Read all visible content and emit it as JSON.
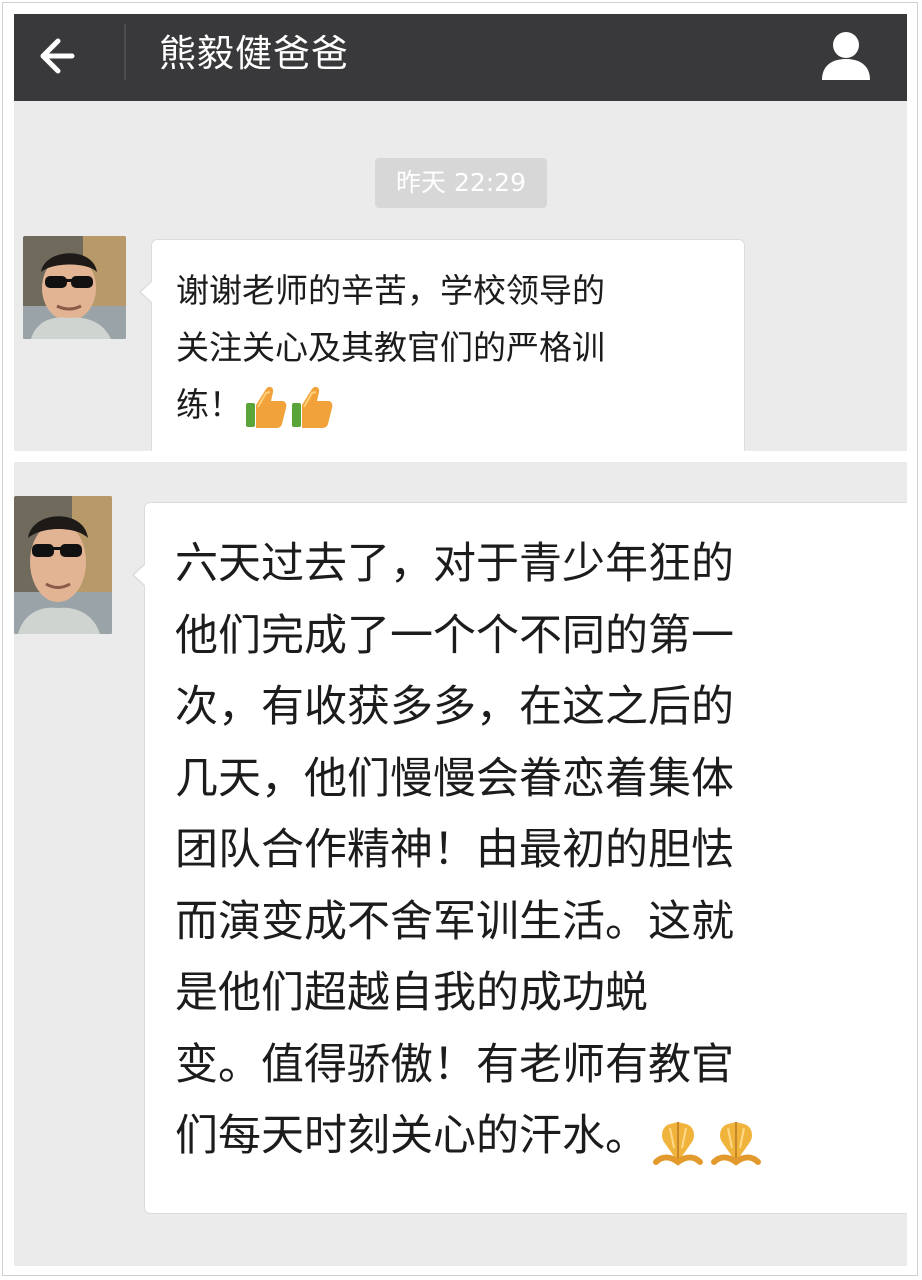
{
  "header": {
    "title": "熊毅健爸爸",
    "back_icon": "back-arrow-icon",
    "profile_icon": "person-icon"
  },
  "timestamp": "昨天 22:29",
  "messages": [
    {
      "avatar": "contact-avatar",
      "lines": [
        "谢谢老师的辛苦，学校领导的",
        "关注关心及其教官们的严格训",
        "练！"
      ],
      "emojis": [
        "thumbs-up-icon",
        "thumbs-up-icon"
      ]
    },
    {
      "avatar": "contact-avatar",
      "lines": [
        "六天过去了，对于青少年狂的",
        "他们完成了一个个不同的第一",
        "次，有收获多多，在这之后的",
        "几天，他们慢慢会眷恋着集体",
        "团队合作精神！由最初的胆怯",
        "而演变成不舍军训生活。这就",
        "是他们超越自我的成功蜕",
        "变。值得骄傲！有老师有教官",
        "们每天时刻关心的汗水。"
      ],
      "emojis": [
        "praying-hands-icon",
        "praying-hands-icon"
      ]
    }
  ],
  "colors": {
    "title_bar": "#39393b",
    "chat_background": "#ebebeb",
    "bubble": "#ffffff",
    "timestamp_pill": "#d7d7d7"
  }
}
